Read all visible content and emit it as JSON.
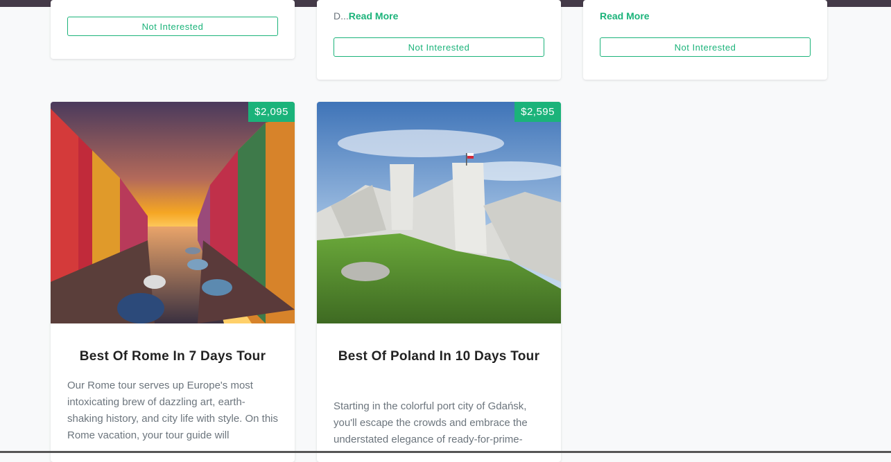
{
  "top_cards": [
    {
      "snippet": "",
      "read_more": "",
      "not_interested": "Not Interested"
    },
    {
      "snippet": "D...",
      "read_more": "Read More",
      "not_interested": "Not Interested"
    },
    {
      "snippet": "",
      "read_more": "Read More",
      "not_interested": "Not Interested"
    }
  ],
  "tours": [
    {
      "price": "$2,095",
      "title": "Best Of Rome In 7 Days Tour",
      "description": "Our Rome tour serves up Europe's most intoxicating brew of dazzling art, earth-shaking history, and city life with style. On this Rome vacation, your tour guide will"
    },
    {
      "price": "$2,595",
      "title": "Best Of Poland In 10 Days Tour",
      "description": "Starting in the colorful port city of Gdańsk, you'll escape the crowds and embrace the understated elegance of ready-for-prime-"
    }
  ],
  "colors": {
    "accent": "#1bb37a",
    "topbar": "#443a48"
  }
}
